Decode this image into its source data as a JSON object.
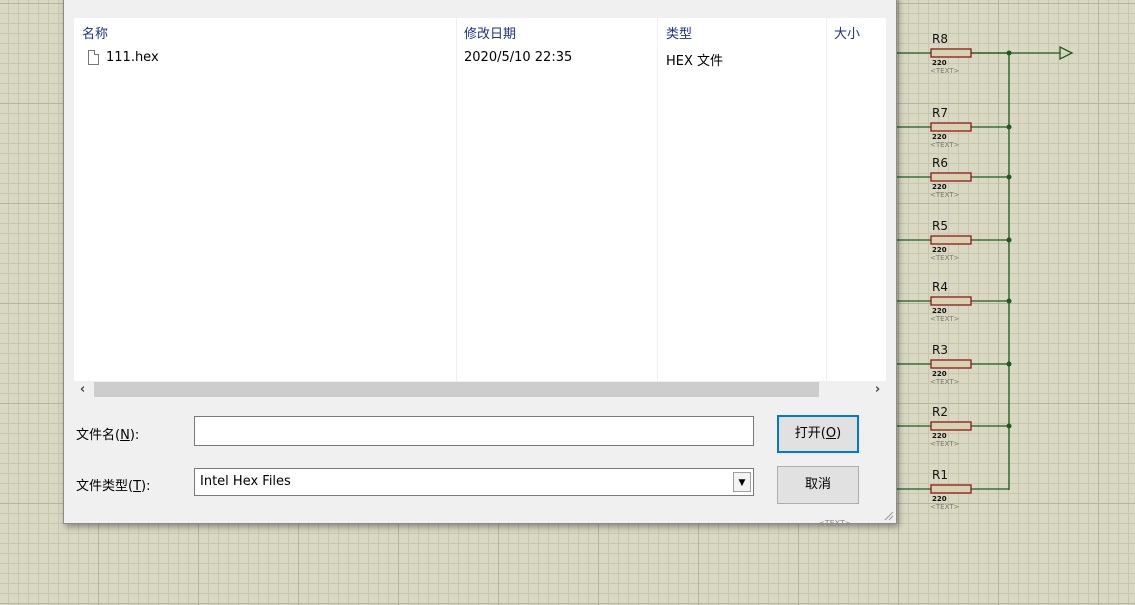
{
  "dialog": {
    "columns": {
      "name": "名称",
      "modified": "修改日期",
      "type": "类型",
      "size": "大小"
    },
    "files": [
      {
        "name": "111.hex",
        "modified": "2020/5/10 22:35",
        "type": "HEX 文件",
        "size": ""
      }
    ],
    "filename_label": "文件名(N):",
    "filename_label_text": "文件名(",
    "filename_label_key": "N",
    "filename_label_end": "):",
    "filename_value": "",
    "filetype_label_text": "文件类型(",
    "filetype_label_key": "T",
    "filetype_label_end": "):",
    "filetype_value": "Intel Hex Files",
    "open_text": "打开(",
    "open_key": "O",
    "open_end": ")",
    "cancel_label": "取消"
  },
  "schematic": {
    "resistors": [
      {
        "label": "R8",
        "value": "220",
        "text": "<TEXT>"
      },
      {
        "label": "R7",
        "value": "220",
        "text": "<TEXT>"
      },
      {
        "label": "R6",
        "value": "220",
        "text": "<TEXT>"
      },
      {
        "label": "R5",
        "value": "220",
        "text": "<TEXT>"
      },
      {
        "label": "R4",
        "value": "220",
        "text": "<TEXT>"
      },
      {
        "label": "R3",
        "value": "220",
        "text": "<TEXT>"
      },
      {
        "label": "R2",
        "value": "220",
        "text": "<TEXT>"
      },
      {
        "label": "R1",
        "value": "220",
        "text": "<TEXT>"
      }
    ],
    "stray_text": "<TEXT>",
    "colors": {
      "background": "#d9d8c2",
      "grid": "#b6b59b",
      "wire": "#1f5a1f",
      "resistor_outline": "#8b1a1a",
      "resistor_fill": "#d9d2b0"
    }
  }
}
